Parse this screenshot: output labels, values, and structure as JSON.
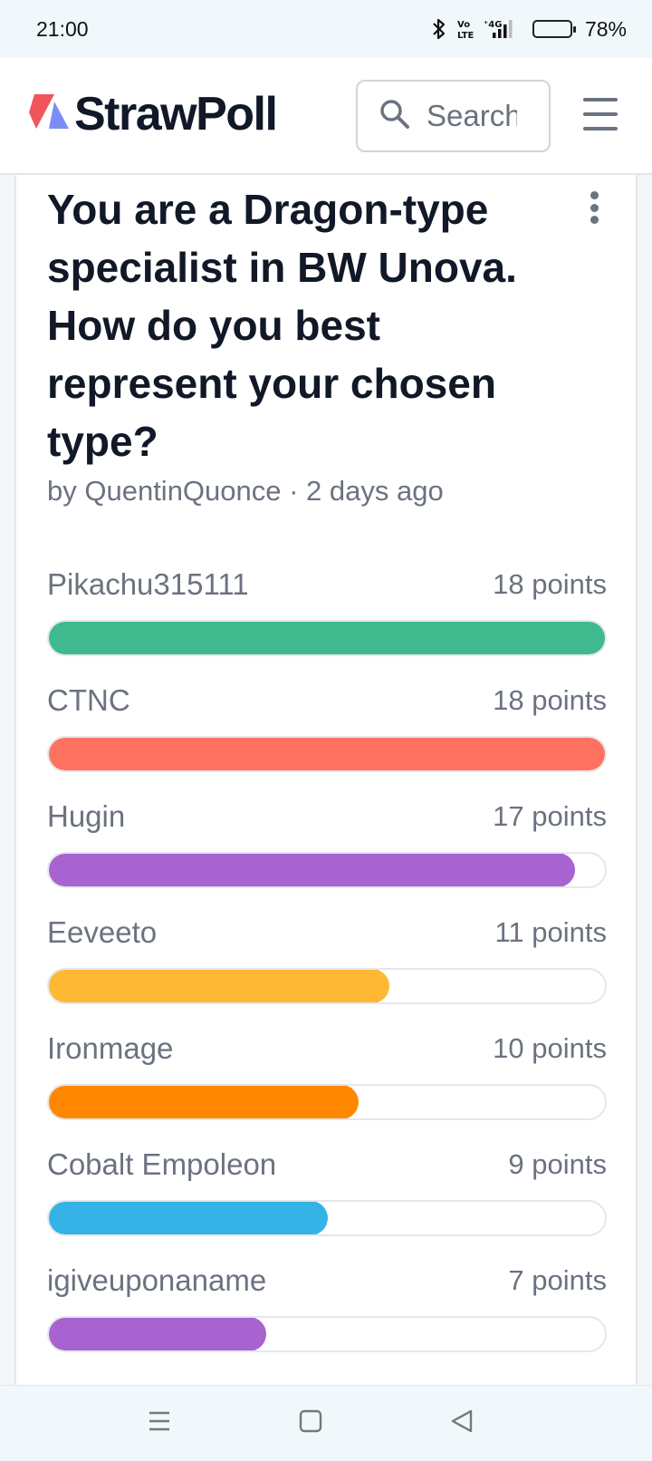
{
  "status_bar": {
    "time": "21:00",
    "battery_percent": "78%",
    "battery_level": 0.78,
    "icons": [
      "bluetooth-icon",
      "volte-icon",
      "signal-4g-icon",
      "battery-icon"
    ]
  },
  "header": {
    "logo_text": "StrawPoll",
    "search_placeholder": "Search",
    "colors": {
      "logo_red": "#f2545b",
      "logo_blue": "#7c8cf8"
    }
  },
  "poll": {
    "title": "You are a Dragon-type specialist in BW Unova. How do you best represent your chosen type?",
    "meta": "by QuentinQuonce · 2 days ago",
    "max_points": 18,
    "results": [
      {
        "name": "Pikachu315111",
        "points_label": "18 points",
        "points": 18,
        "color": "#41b98f"
      },
      {
        "name": "CTNC",
        "points_label": "18 points",
        "points": 18,
        "color": "#ff7262"
      },
      {
        "name": "Hugin",
        "points_label": "17 points",
        "points": 17,
        "color": "#a763cf"
      },
      {
        "name": "Eeveeto",
        "points_label": "11 points",
        "points": 11,
        "color": "#ffb833"
      },
      {
        "name": "Ironmage",
        "points_label": "10 points",
        "points": 10,
        "color": "#ff8800"
      },
      {
        "name": "Cobalt Empoleon",
        "points_label": "9 points",
        "points": 9,
        "color": "#35b3e6"
      },
      {
        "name": "igiveuponaname",
        "points_label": "7 points",
        "points": 7,
        "color": "#a763cf"
      }
    ]
  },
  "navbar": {
    "icons": [
      "recent-apps-icon",
      "home-icon",
      "back-icon"
    ]
  }
}
